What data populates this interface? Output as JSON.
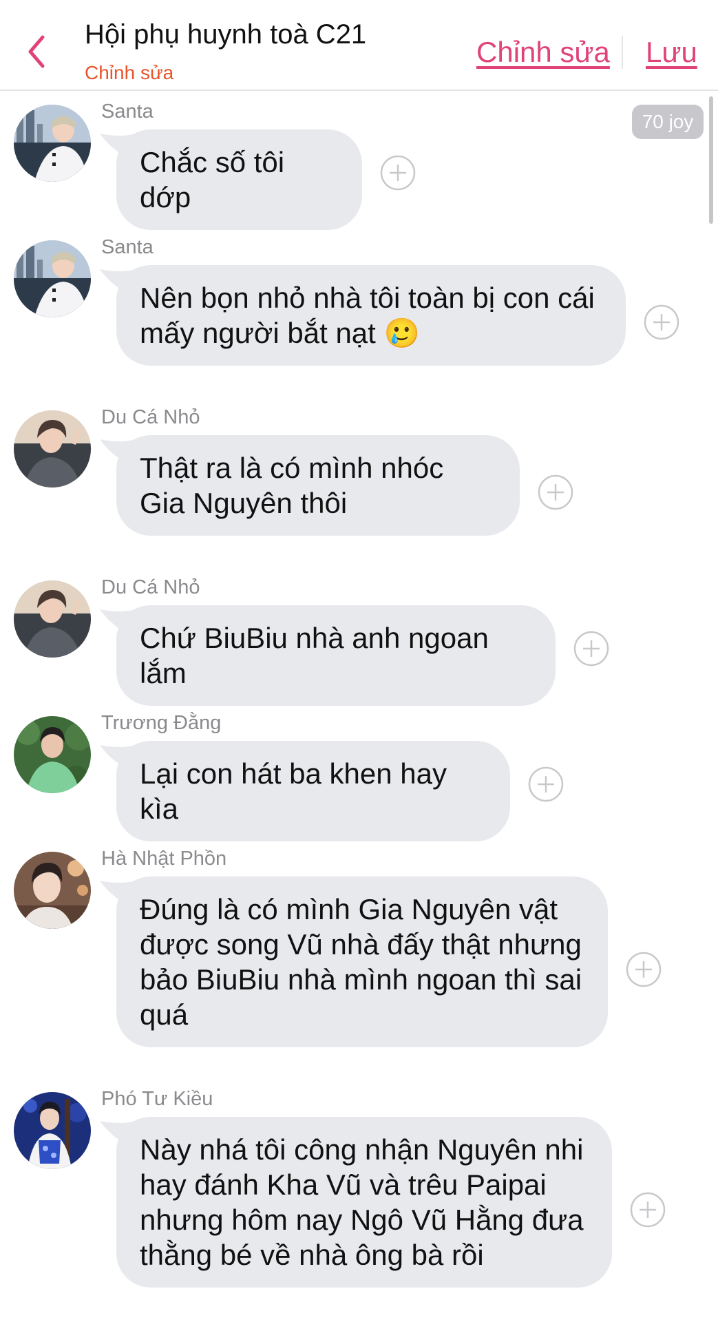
{
  "header": {
    "back_label": "<",
    "title": "Hội phụ huynh toà C21",
    "subtitle": "Chỉnh sửa",
    "edit_label": "Chỉnh sửa",
    "save_label": "Lưu"
  },
  "badge": "70 joy",
  "colors": {
    "accent": "#e0437a",
    "subtitle": "#e8542c",
    "bubble": "#e8e9ed",
    "sender": "#8a8a8e"
  },
  "messages": [
    {
      "sender": "Santa",
      "text": "Chắc số tôi dớp",
      "avatar": "santa"
    },
    {
      "sender": "Santa",
      "text": "Nên bọn nhỏ nhà tôi toàn bị con cái mấy người bắt nạt 🥲",
      "avatar": "santa"
    },
    {
      "sender": "Du Cá Nhỏ",
      "text": "Thật ra là có mình nhóc Gia Nguyên thôi",
      "avatar": "du"
    },
    {
      "sender": "Du Cá Nhỏ",
      "text": "Chứ BiuBiu nhà anh ngoan lắm",
      "avatar": "du"
    },
    {
      "sender": "Trương Đằng",
      "text": "Lại con hát ba khen hay kìa",
      "avatar": "truong"
    },
    {
      "sender": "Hà Nhật Phồn",
      "text": "Đúng là có mình Gia Nguyên vật được song Vũ nhà đấy thật nhưng bảo BiuBiu nhà mình ngoan thì sai quá",
      "avatar": "ha"
    },
    {
      "sender": "Phó Tư Kiều",
      "text": "Này nhá tôi công nhận Nguyên nhi hay đánh Kha Vũ và trêu Paipai nhưng hôm nay Ngô Vũ Hằng đưa thằng bé về nhà ông bà rồi",
      "avatar": "pho"
    }
  ]
}
